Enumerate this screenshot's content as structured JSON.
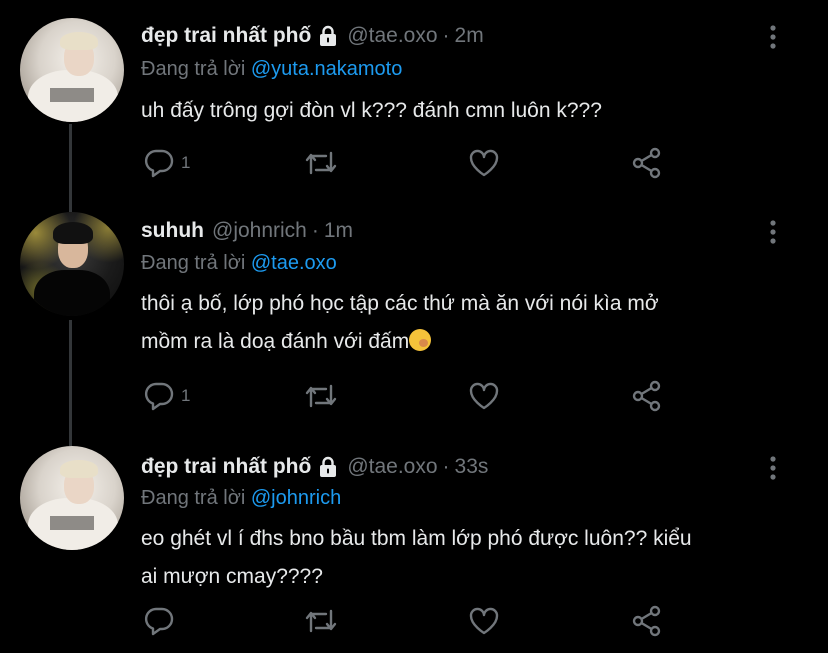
{
  "tweets": [
    {
      "name": "đẹp trai nhất phố",
      "handle": "@tae.oxo",
      "separator": "·",
      "time": "2m",
      "replying_prefix": "Đang trả lời",
      "replying_to": "@yuta.nakamoto",
      "text_lines": [
        "uh đấy trông gợi đòn vl k??? đánh cmn luôn k???"
      ],
      "reply_count": "1",
      "protected": true,
      "avatar_icon": "avatar-light"
    },
    {
      "name": "suhuh",
      "handle": "@johnrich",
      "separator": "·",
      "time": "1m",
      "replying_prefix": "Đang trả lời",
      "replying_to": "@tae.oxo",
      "text_lines": [
        "thôi ạ bố, lớp phó học tập các thứ mà ăn với nói kìa mở",
        "mồm ra là doạ đánh với đấm"
      ],
      "reply_count": "1",
      "protected": false,
      "avatar_icon": "avatar-dark"
    },
    {
      "name": "đẹp trai nhất phố",
      "handle": "@tae.oxo",
      "separator": "·",
      "time": "33s",
      "replying_prefix": "Đang trả lời",
      "replying_to": "@johnrich",
      "text_lines": [
        "eo ghét vl í đhs bno bầu tbm làm lớp phó được luôn?? kiểu",
        "ai mượn cmay????"
      ],
      "reply_count": "",
      "protected": true,
      "avatar_icon": "avatar-light"
    }
  ],
  "colors": {
    "background": "#000000",
    "text": "#e7e9ea",
    "muted": "#71767b",
    "accent": "#1d9bf0",
    "thread_line": "#333639"
  },
  "icons": [
    "reply-icon",
    "retweet-icon",
    "like-icon",
    "share-icon",
    "more-icon",
    "lock-icon",
    "emoji-kissing-icon"
  ]
}
